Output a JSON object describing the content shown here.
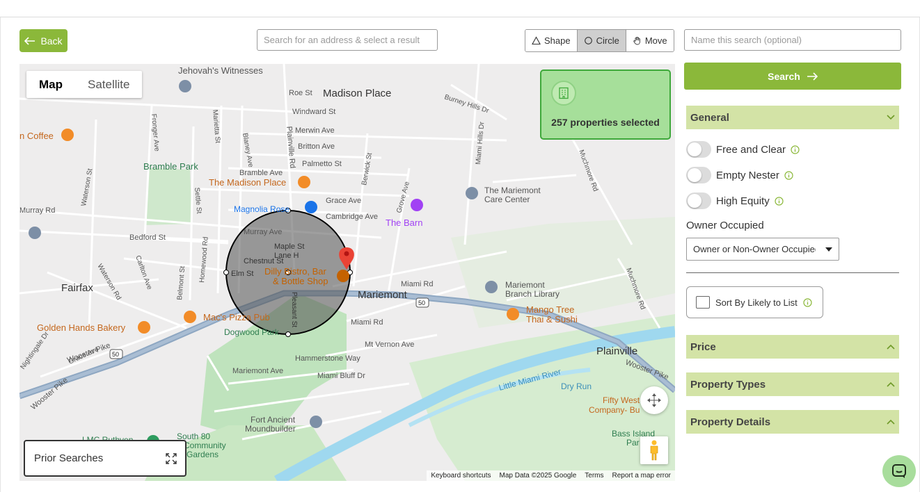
{
  "toolbar": {
    "back_label": "Back",
    "address_placeholder": "Search for an address & select a result",
    "shape_label": "Shape",
    "circle_label": "Circle",
    "move_label": "Move",
    "name_placeholder": "Name this search (optional)",
    "search_label": "Search"
  },
  "map": {
    "type_map": "Map",
    "type_satellite": "Satellite",
    "selection_count_text": "257 properties selected",
    "prior_searches_label": "Prior Searches",
    "attribution": {
      "shortcuts": "Keyboard shortcuts",
      "data": "Map Data ©2025 Google",
      "terms": "Terms",
      "report": "Report a map error"
    },
    "labels": {
      "jehovah": "Jehovah's Witnesses",
      "madison_place": "Madison Place",
      "roe_st": "Roe St",
      "windward": "Windward St",
      "merwin": "Merwin Ave",
      "britton": "Britton Ave",
      "palmetto": "Palmetto St",
      "bramble_ave": "Bramble Ave",
      "grace_ave": "Grace Ave",
      "cambridge": "Cambridge Ave",
      "murray_ave": "Murray Ave",
      "maple_st": "Maple St",
      "lane_h": "Lane H",
      "chestnut": "Chestnut St",
      "elm_st": "Elm St",
      "mariemont": "Mariemont",
      "mariemont_care": "The Mariemont",
      "mariemont_care2": "Care Center",
      "mariemont_lib": "Mariemont",
      "mariemont_lib2": "Branch Library",
      "the_barn": "The Barn",
      "magnolia": "Magnolia Rose",
      "madison_place_cafe": "The Madison Place",
      "coffee": "n Coffee",
      "bramble_park": "Bramble Park",
      "murray_rd": "Murray Rd",
      "bedford": "Bedford St",
      "fairfax": "Fairfax",
      "golden_hands": "Golden Hands Bakery",
      "macs": "Mac's Pizza Pub",
      "dogwood": "Dogwood Park",
      "dilly": "Dilly Bistro, Bar",
      "dilly2": "& Bottle Shop",
      "miami_rd": "Miami Rd",
      "miami_rd2": "Miami Rd",
      "mt_vernon": "Mt Vernon Ave",
      "hammerstone": "Hammerstone Way",
      "miami_bluff": "Miami Bluff Dr",
      "mariemont_ave": "Mariemont Ave",
      "mango": "Mango Tree",
      "mango2": "Thai & Sushi",
      "plainville": "Plainville",
      "wooster_pike": "Wooster Pike",
      "wooster_pike2": "Wooster Pike",
      "wooster_pike3": "Wooster Pike",
      "little_miami": "Little Miami River",
      "dry_run": "Dry Run",
      "fifty_west": "Fifty West",
      "fifty_west2": "Company- Bu",
      "fort_ancient": "Fort Ancient",
      "fort_ancient2": "Moundbuilder",
      "south80": "South 80",
      "south80b": "Community",
      "south80c": "Gardens",
      "lmc": "LMC Ruthven",
      "bass_island": "Bass Island",
      "bass_island2": "Par",
      "burney": "Burney Hills Dr",
      "miami_hills": "Miami Hills Dr",
      "muchmore": "Muchmore Rd",
      "muchmore2": "Muchmore Rd",
      "plainville_rd": "Plainville Rd",
      "marietta": "Marietta St",
      "blaney": "Blaney Ave",
      "settle": "Settle St",
      "homewood": "Homewood Rd",
      "belmont": "Belmont St",
      "carlton": "Carlton Ave",
      "waterson": "Waterson Rd",
      "waterson_st": "Waterson St",
      "fronger": "Fronger Ave",
      "berwick": "Berwick St",
      "grove": "Grove Ave",
      "pleasant": "Pleasant St",
      "nightingale": "Nightingale Dr",
      "grace_ave2": "Grace Ave",
      "r50a": "50",
      "r50b": "50"
    }
  },
  "panel": {
    "general_label": "General",
    "toggles": [
      {
        "label": "Free and Clear"
      },
      {
        "label": "Empty Nester"
      },
      {
        "label": "High Equity"
      }
    ],
    "owner_occupied_label": "Owner Occupied",
    "owner_occupied_value": "Owner or Non-Owner Occupied",
    "sort_label": "Sort By Likely to List",
    "price_label": "Price",
    "property_types_label": "Property Types",
    "property_details_label": "Property Details"
  },
  "colors": {
    "accent": "#8bb83a",
    "section_bg": "#d3e3a6",
    "card_bg": "#a6df9a",
    "card_border": "#3ea83a"
  }
}
